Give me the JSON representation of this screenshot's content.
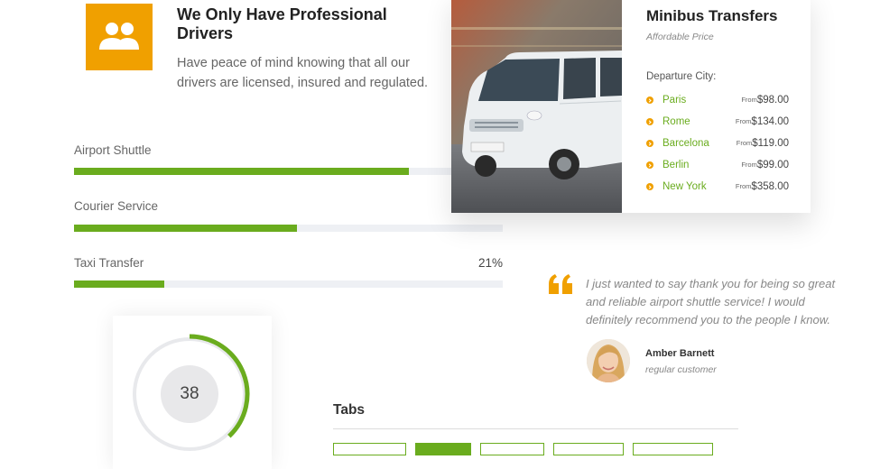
{
  "feature": {
    "icon": "users-icon",
    "icon_color": "#f0a000",
    "title": "We Only Have Professional Drivers",
    "text": "Have peace of mind knowing that all our drivers are licensed, insured and regulated."
  },
  "skills": [
    {
      "label": "Airport Shuttle",
      "percent": 78,
      "percent_text": ""
    },
    {
      "label": "Courier Service",
      "percent": 52,
      "percent_text": ""
    },
    {
      "label": "Taxi Transfer",
      "percent": 21,
      "percent_text": "21%"
    }
  ],
  "transfer_card": {
    "title": "Minibus Transfers",
    "subtitle": "Affordable Price",
    "departure_label": "Departure City:",
    "cities": [
      {
        "name": "Paris",
        "from": "From",
        "price": "$98.00"
      },
      {
        "name": "Rome",
        "from": "From",
        "price": "$134.00"
      },
      {
        "name": "Barcelona",
        "from": "From",
        "price": "$119.00"
      },
      {
        "name": "Berlin",
        "from": "From",
        "price": "$99.00"
      },
      {
        "name": "New York",
        "from": "From",
        "price": "$358.00"
      }
    ]
  },
  "testimonial": {
    "quote": "I just wanted to say thank you for being so great and reliable airport shuttle service! I would definitely recommend you to the people I know.",
    "author": "Amber Barnett",
    "role": "regular customer"
  },
  "counter": {
    "value": "38",
    "progress": 0.38
  },
  "tabs": {
    "title": "Tabs",
    "items": [
      "",
      "",
      "",
      "",
      ""
    ],
    "active_index": 1
  },
  "colors": {
    "accent_green": "#6aac1e",
    "accent_orange": "#f0a000"
  }
}
